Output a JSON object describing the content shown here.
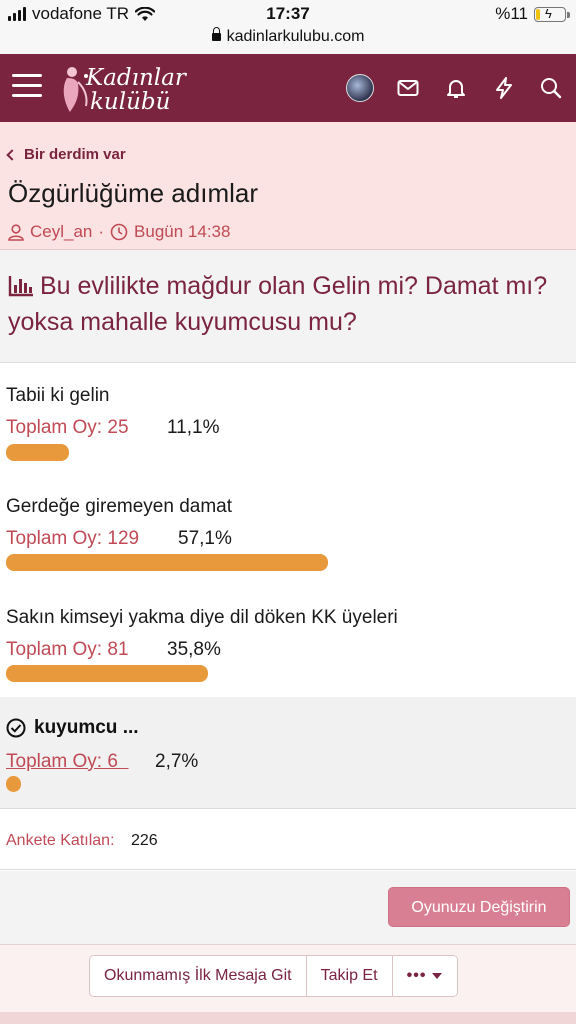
{
  "status_bar": {
    "carrier": "vodafone TR",
    "time": "17:37",
    "battery": "%11",
    "url": "kadinlarkulubu.com"
  },
  "header": {
    "logo_text_line1": "Kadınlar",
    "logo_text_line2": "kulübü",
    "brand_color": "#7a2440",
    "icons": [
      "menu-icon",
      "avatar",
      "mail-icon",
      "bell-icon",
      "bolt-icon",
      "search-icon"
    ]
  },
  "breadcrumb": {
    "label": "Bir derdim var"
  },
  "thread": {
    "title": "Özgürlüğüme adımlar",
    "author": "Ceyl_an",
    "separator": "·",
    "time": "Bugün 14:38"
  },
  "poll": {
    "question": "Bu evlilikte mağdur olan Gelin mi? Damat mı? yoksa mahalle kuyumcusu mu?",
    "vote_label": "Toplam Oy:",
    "options": [
      {
        "label": "Tabii ki gelin",
        "votes": "25",
        "percent": "11,1%",
        "fraction": 0.111
      },
      {
        "label": "Gerdeğe giremeyen damat",
        "votes": "129",
        "percent": "57,1%",
        "fraction": 0.571
      },
      {
        "label": "Sakın kimseyi yakma diye dil döken KK üyeleri",
        "votes": "81",
        "percent": "35,8%",
        "fraction": 0.358
      }
    ],
    "voted_option": {
      "label": "kuyumcu ...",
      "votes": "6",
      "percent": "2,7%",
      "fraction": 0.027
    },
    "participants_label": "Ankete Katılan:",
    "participants_count": "226",
    "bar_color": "#e8993b",
    "change_vote_button": "Oyunuzu Değiştirin"
  },
  "bottom_actions": {
    "unread_button": "Okunmamış İlk Mesaja Git",
    "follow_button": "Takip Et",
    "more_button": "•••"
  }
}
